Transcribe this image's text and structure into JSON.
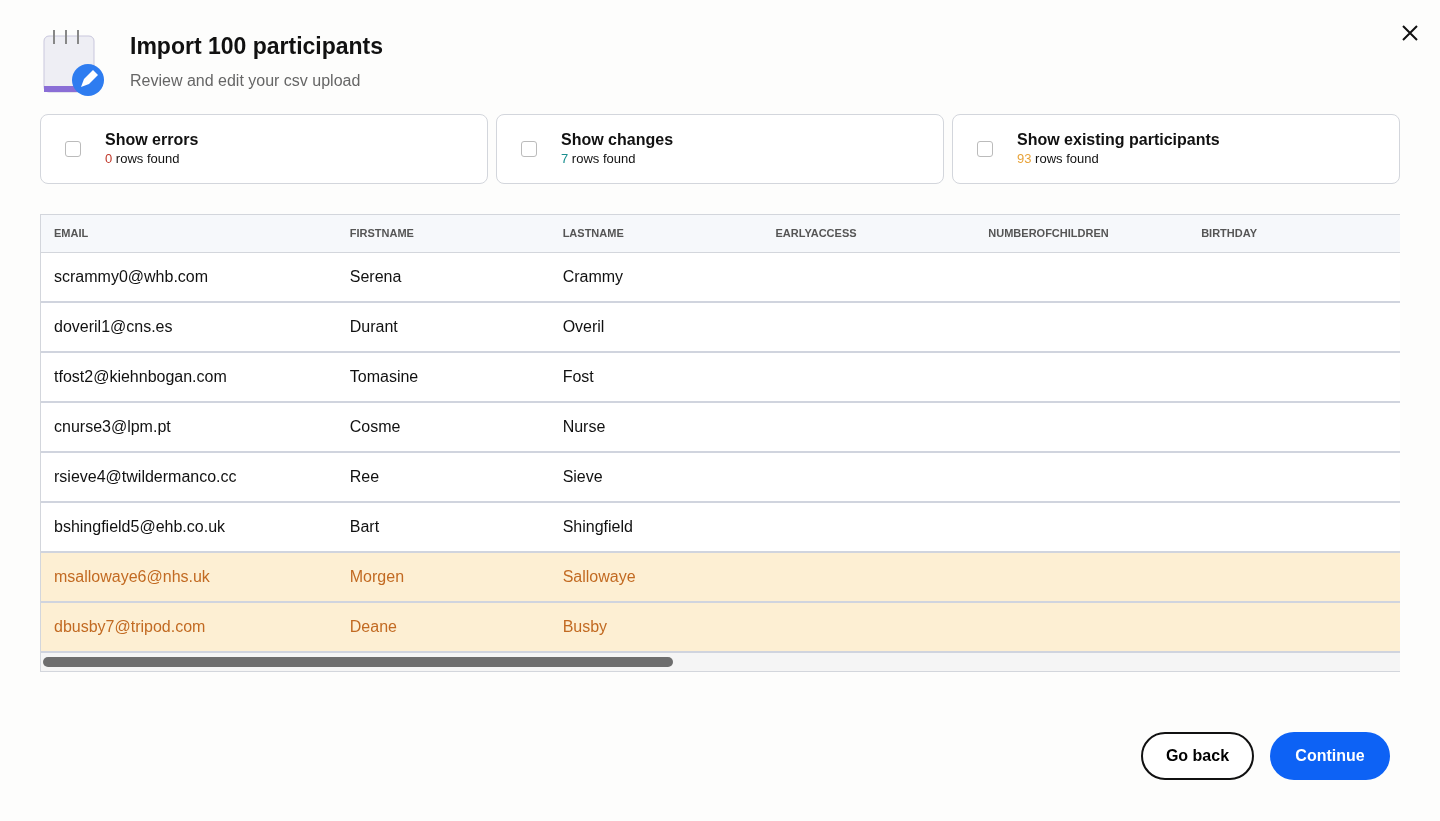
{
  "dialog": {
    "title": "Import 100 participants",
    "subtitle": "Review and edit your csv upload"
  },
  "filters": [
    {
      "label": "Show errors",
      "count": "0",
      "count_text": "rows found",
      "checked": false,
      "color": "#c0392b"
    },
    {
      "label": "Show changes",
      "count": "7",
      "count_text": "rows found",
      "checked": false,
      "color": "#1a8f8f"
    },
    {
      "label": "Show existing participants",
      "count": "93",
      "count_text": "rows found",
      "checked": false,
      "color": "#e8a33a"
    }
  ],
  "table": {
    "columns": [
      "EMAIL",
      "FIRSTNAME",
      "LASTNAME",
      "EARLYACCESS",
      "NUMBEROFCHILDREN",
      "BIRTHDAY"
    ],
    "rows": [
      {
        "cells": [
          "scrammy0@whb.com",
          "Serena",
          "Crammy"
        ],
        "highlighted": false
      },
      {
        "cells": [
          "doveril1@cns.es",
          "Durant",
          "Overil"
        ],
        "highlighted": false
      },
      {
        "cells": [
          "tfost2@kiehnbogan.com",
          "Tomasine",
          "Fost"
        ],
        "highlighted": false
      },
      {
        "cells": [
          "cnurse3@lpm.pt",
          "Cosme",
          "Nurse"
        ],
        "highlighted": false
      },
      {
        "cells": [
          "rsieve4@twildermanco.cc",
          "Ree",
          "Sieve"
        ],
        "highlighted": false
      },
      {
        "cells": [
          "bshingfield5@ehb.co.uk",
          "Bart",
          "Shingfield"
        ],
        "highlighted": false
      },
      {
        "cells": [
          "msallowaye6@nhs.uk",
          "Morgen",
          "Sallowaye"
        ],
        "highlighted": true
      },
      {
        "cells": [
          "dbusby7@tripod.com",
          "Deane",
          "Busby"
        ],
        "highlighted": true
      }
    ]
  },
  "buttons": [
    {
      "label": "Go back",
      "kind": "secondary"
    },
    {
      "label": "Continue",
      "kind": "primary"
    }
  ]
}
